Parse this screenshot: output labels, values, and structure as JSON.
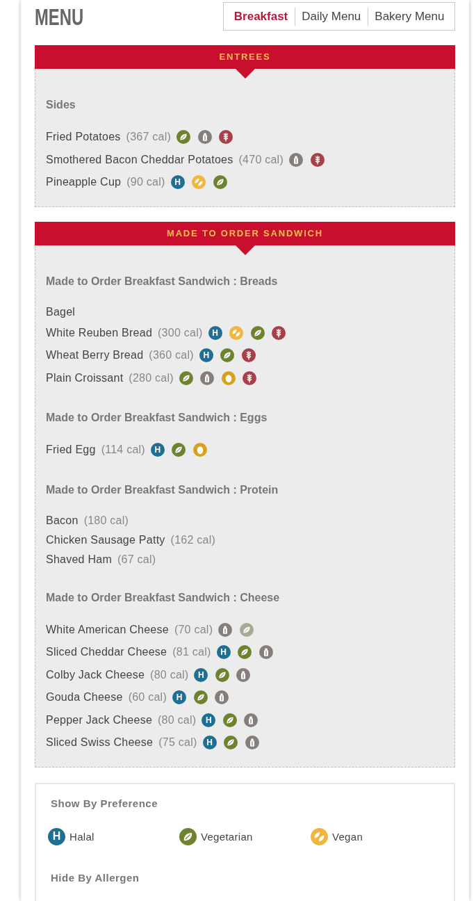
{
  "header": {
    "title": "MENU"
  },
  "tabs": [
    {
      "label": "Breakfast",
      "selected": true
    },
    {
      "label": "Daily Menu",
      "selected": false
    },
    {
      "label": "Bakery Menu",
      "selected": false
    }
  ],
  "sections": [
    {
      "title": "ENTREES",
      "groups": [
        {
          "heading": "Sides",
          "items": [
            {
              "name": "Fried Potatoes",
              "calories": "(367 cal)",
              "badges": [
                {
                  "kind": "vegetarian",
                  "dimmed": false
                },
                {
                  "kind": "milk",
                  "dimmed": false
                },
                {
                  "kind": "wheat",
                  "dimmed": false
                }
              ]
            },
            {
              "name": "Smothered Bacon Cheddar Potatoes",
              "calories": "(470 cal)",
              "badges": [
                {
                  "kind": "milk",
                  "dimmed": false
                },
                {
                  "kind": "wheat",
                  "dimmed": false
                }
              ]
            },
            {
              "name": "Pineapple Cup",
              "calories": "(90 cal)",
              "badges": [
                {
                  "kind": "halal",
                  "symbol": "H",
                  "dimmed": false
                },
                {
                  "kind": "vegan",
                  "dimmed": false
                },
                {
                  "kind": "vegetarian",
                  "dimmed": false
                }
              ]
            }
          ]
        }
      ]
    },
    {
      "title": "MADE TO ORDER SANDWICH",
      "groups": [
        {
          "heading": "Made to Order Breakfast Sandwich : Breads",
          "items": [
            {
              "name": "Bagel"
            },
            {
              "name": "White Reuben Bread",
              "calories": "(300 cal)",
              "badges": [
                {
                  "kind": "halal",
                  "symbol": "H",
                  "dimmed": false
                },
                {
                  "kind": "vegan",
                  "dimmed": false
                },
                {
                  "kind": "vegetarian",
                  "dimmed": false
                },
                {
                  "kind": "wheat",
                  "dimmed": false
                }
              ]
            },
            {
              "name": "Wheat Berry Bread",
              "calories": "(360 cal)",
              "badges": [
                {
                  "kind": "halal",
                  "symbol": "H",
                  "dimmed": false
                },
                {
                  "kind": "vegetarian",
                  "dimmed": false
                },
                {
                  "kind": "wheat",
                  "dimmed": false
                }
              ]
            },
            {
              "name": "Plain Croissant",
              "calories": "(280 cal)",
              "badges": [
                {
                  "kind": "vegetarian",
                  "dimmed": false
                },
                {
                  "kind": "milk",
                  "dimmed": false
                },
                {
                  "kind": "egg",
                  "dimmed": false
                },
                {
                  "kind": "wheat",
                  "dimmed": false
                }
              ]
            }
          ]
        },
        {
          "heading": "Made to Order Breakfast Sandwich : Eggs",
          "items": [
            {
              "name": "Fried Egg",
              "calories": "(114 cal)",
              "badges": [
                {
                  "kind": "halal",
                  "symbol": "H",
                  "dimmed": false
                },
                {
                  "kind": "vegetarian",
                  "dimmed": false
                },
                {
                  "kind": "egg",
                  "dimmed": false
                }
              ]
            }
          ]
        },
        {
          "heading": "Made to Order Breakfast Sandwich : Protein",
          "items": [
            {
              "name": "Bacon",
              "calories": "(180 cal)"
            },
            {
              "name": "Chicken Sausage Patty",
              "calories": "(162 cal)"
            },
            {
              "name": "Shaved Ham",
              "calories": "(67 cal)"
            }
          ]
        },
        {
          "heading": "Made to Order Breakfast Sandwich : Cheese",
          "items": [
            {
              "name": "White American Cheese",
              "calories": "(70 cal)",
              "badges": [
                {
                  "kind": "milk",
                  "dimmed": false
                },
                {
                  "kind": "vegetarian",
                  "dimmed": true
                }
              ]
            },
            {
              "name": "Sliced Cheddar Cheese",
              "calories": "(81 cal)",
              "badges": [
                {
                  "kind": "halal",
                  "symbol": "H",
                  "dimmed": false
                },
                {
                  "kind": "vegetarian",
                  "dimmed": false
                },
                {
                  "kind": "milk",
                  "dimmed": false
                }
              ]
            },
            {
              "name": "Colby Jack Cheese",
              "calories": "(80 cal)",
              "badges": [
                {
                  "kind": "halal",
                  "symbol": "H",
                  "dimmed": false
                },
                {
                  "kind": "vegetarian",
                  "dimmed": false
                },
                {
                  "kind": "milk",
                  "dimmed": false
                }
              ]
            },
            {
              "name": "Gouda Cheese",
              "calories": "(60 cal)",
              "badges": [
                {
                  "kind": "halal",
                  "symbol": "H",
                  "dimmed": false
                },
                {
                  "kind": "vegetarian",
                  "dimmed": false
                },
                {
                  "kind": "milk",
                  "dimmed": false
                }
              ]
            },
            {
              "name": "Pepper Jack Cheese",
              "calories": "(80 cal)",
              "badges": [
                {
                  "kind": "halal",
                  "symbol": "H",
                  "dimmed": false
                },
                {
                  "kind": "vegetarian",
                  "dimmed": false
                },
                {
                  "kind": "milk",
                  "dimmed": false
                }
              ]
            },
            {
              "name": "Sliced Swiss Cheese",
              "calories": "(75 cal)",
              "badges": [
                {
                  "kind": "halal",
                  "symbol": "H",
                  "dimmed": false
                },
                {
                  "kind": "vegetarian",
                  "dimmed": false
                },
                {
                  "kind": "milk",
                  "dimmed": false
                }
              ]
            }
          ]
        }
      ]
    }
  ],
  "preferences": {
    "heading": "Show By Preference",
    "items": [
      {
        "kind": "halal",
        "symbol": "H",
        "label": "Halal"
      },
      {
        "kind": "vegetarian",
        "label": "Vegetarian"
      },
      {
        "kind": "vegan",
        "label": "Vegan"
      }
    ]
  },
  "allergens": {
    "heading": "Hide By Allergen"
  }
}
